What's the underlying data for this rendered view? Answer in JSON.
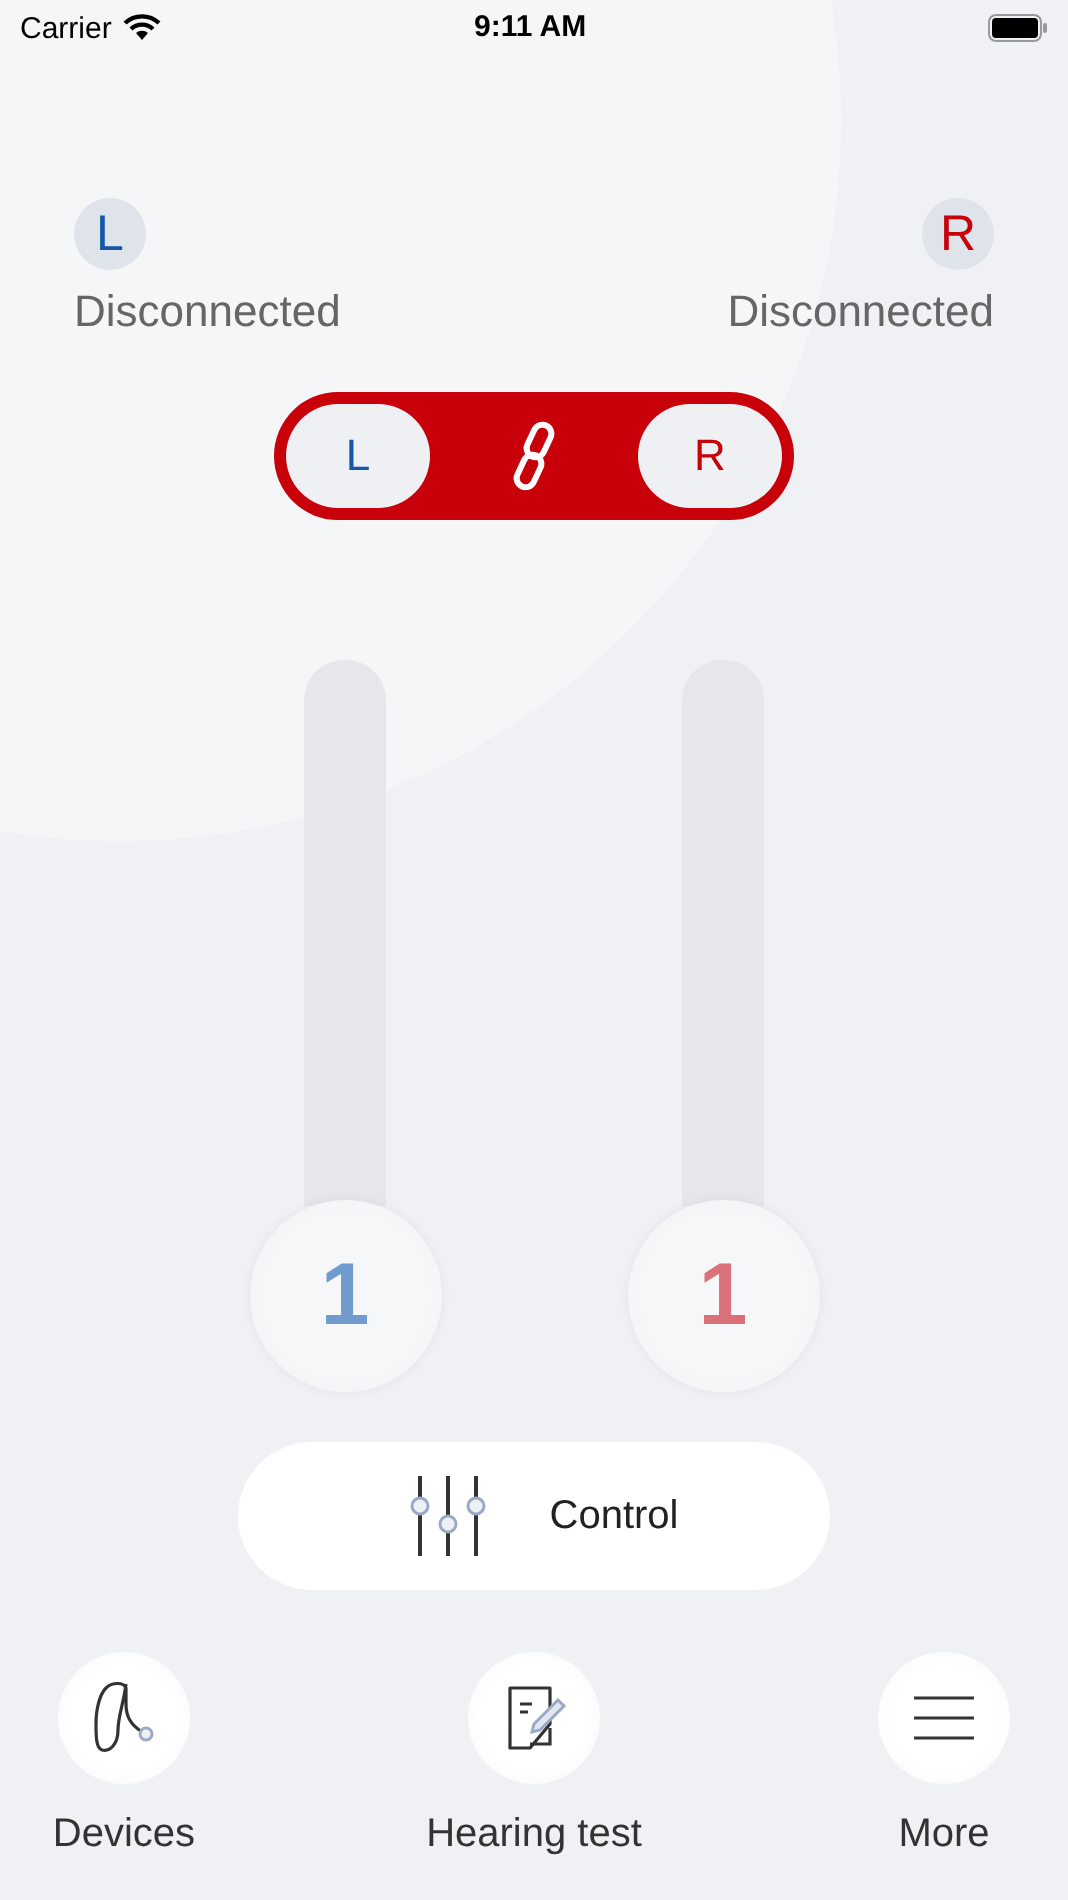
{
  "status_bar": {
    "carrier": "Carrier",
    "time": "9:11 AM"
  },
  "ears": [
    {
      "kind": "left",
      "letter": "L",
      "status": "Disconnected"
    },
    {
      "kind": "right",
      "letter": "R",
      "status": "Disconnected"
    }
  ],
  "link_toggle": {
    "left": "L",
    "right": "R",
    "linked": true
  },
  "volumes": [
    {
      "kind": "left",
      "value": "1",
      "level": 0
    },
    {
      "kind": "right",
      "value": "1",
      "level": 0
    }
  ],
  "control_button": {
    "label": "Control"
  },
  "nav": [
    {
      "kind": "devices",
      "label": "Devices"
    },
    {
      "kind": "test",
      "label": "Hearing test"
    },
    {
      "kind": "more",
      "label": "More"
    }
  ]
}
